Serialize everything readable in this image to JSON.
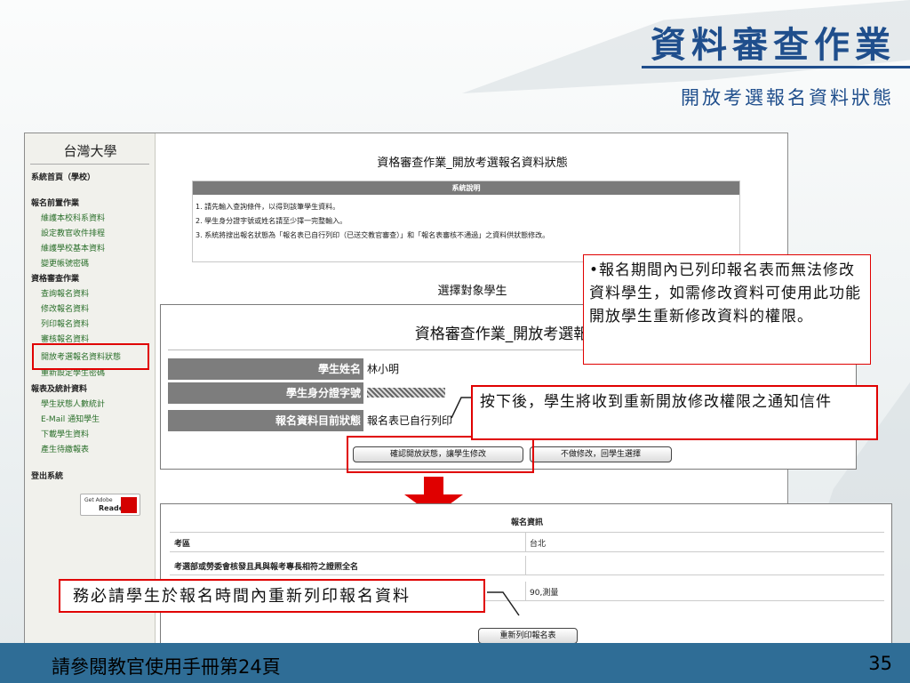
{
  "slide": {
    "title": "資料審查作業",
    "subtitle": "開放考選報名資料狀態",
    "footer": "請參閱教官使用手冊第24頁",
    "page_number": "35"
  },
  "sidebar": {
    "university": "台灣大學",
    "items": [
      {
        "label": "系統首頁（學校）",
        "type": "head"
      },
      {
        "label": "報名前置作業",
        "type": "head"
      },
      {
        "label": "維護本校科系資料",
        "type": "link"
      },
      {
        "label": "設定教官收件排程",
        "type": "link"
      },
      {
        "label": "維護學校基本資料",
        "type": "link"
      },
      {
        "label": "變更帳號密碼",
        "type": "link"
      },
      {
        "label": "資格審查作業",
        "type": "head"
      },
      {
        "label": "查詢報名資料",
        "type": "link"
      },
      {
        "label": "修改報名資料",
        "type": "link"
      },
      {
        "label": "列印報名資料",
        "type": "link"
      },
      {
        "label": "審核報名資料",
        "type": "link"
      },
      {
        "label": "開放考選報名資料狀態",
        "type": "link",
        "selected": true
      },
      {
        "label": "重新設定學生密碼",
        "type": "link"
      },
      {
        "label": "報表及統計資料",
        "type": "head"
      },
      {
        "label": "學生狀態人數統計",
        "type": "link"
      },
      {
        "label": "E-Mail 通知學生",
        "type": "link"
      },
      {
        "label": "下載學生資料",
        "type": "link"
      },
      {
        "label": "產生待繳報表",
        "type": "link"
      },
      {
        "label": "登出系統",
        "type": "head"
      }
    ],
    "adobe_get": "Get Adobe",
    "adobe_reader": "Reader"
  },
  "main": {
    "title": "資格審查作業_開放考選報名資料狀態",
    "system_note_header": "系統說明",
    "system_notes": [
      "1. 請先輸入查詢條件，以得到該筆學生資料。",
      "2. 學生身分證字號或姓名請至少擇一完整輸入。",
      "3. 系統將搜出報名狀態為「報名表已自行列印（已送交教官審查）」和「報名表審核不通過」之資料供狀態修改。"
    ],
    "select_title": "選擇對象學生"
  },
  "form": {
    "title": "資格審查作業_開放考選報名",
    "rows": [
      {
        "label": "學生姓名",
        "value": "林小明"
      },
      {
        "label": "學生身分證字號",
        "value": ""
      },
      {
        "label": "報名資料目前狀態",
        "value": "報名表已自行列印"
      }
    ],
    "confirm_button": "確認開放狀態，讓學生修改",
    "cancel_button": "不做修改，回學生選擇"
  },
  "report": {
    "header": "報名資訊",
    "rows": [
      {
        "label": "考區",
        "value": "台北"
      },
      {
        "label": "考選部或勞委會核發且具與報考專長相符之證照全名",
        "value": ""
      },
      {
        "label": "",
        "value": "90,測量"
      }
    ],
    "reprint_button": "重新列印報名表"
  },
  "callouts": {
    "top_right": "•報名期間內已列印報名表而無法修改資料學生，如需修改資料可使用此功能開放學生重新修改資料的權限。",
    "middle": "按下後，學生將收到重新開放修改權限之通知信件",
    "bottom": "務必請學生於報名時間內重新列印報名資料"
  },
  "colors": {
    "accent": "#1f4e8c",
    "highlight": "#e00000",
    "sidebar_link": "#2a6f2a",
    "bottom_bar": "#2f6d96",
    "arrow": "#e00000"
  }
}
